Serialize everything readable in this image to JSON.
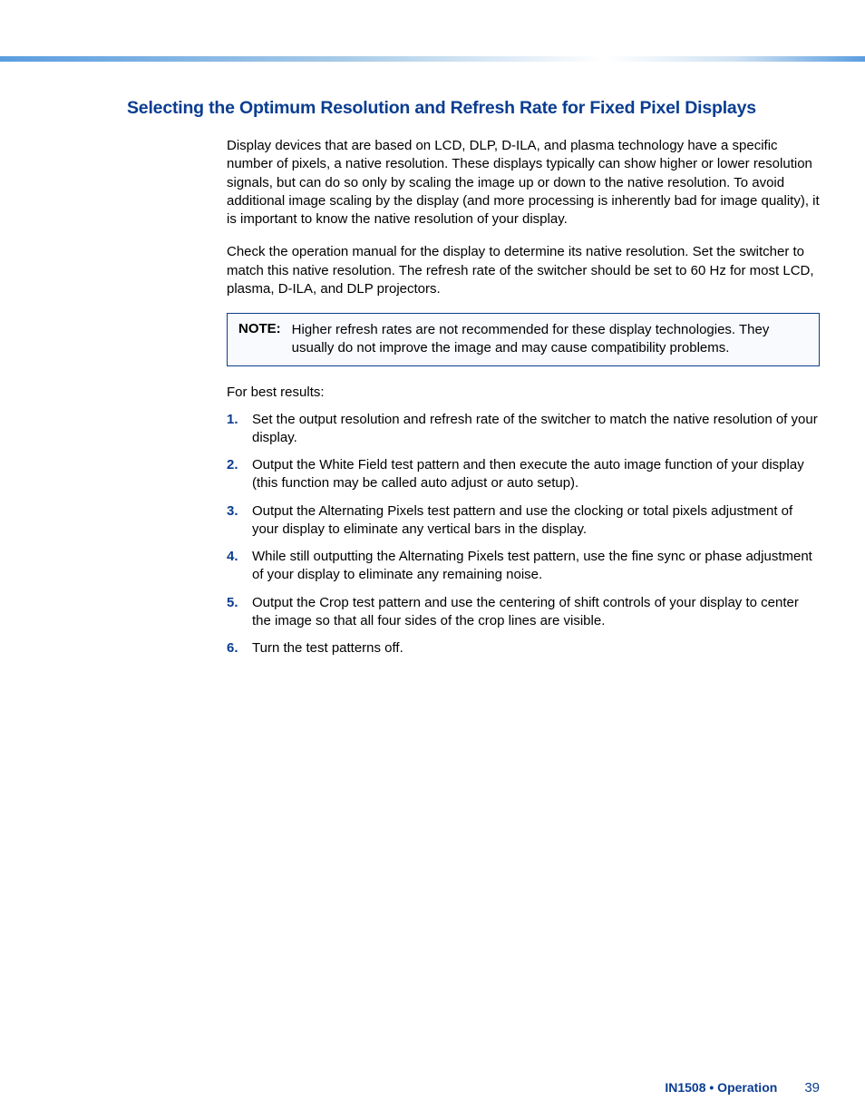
{
  "heading": "Selecting the Optimum Resolution and Refresh Rate for Fixed Pixel Displays",
  "para1": "Display devices that are based on LCD, DLP, D-ILA, and plasma technology have a specific number of pixels, a native resolution. These displays typically can show higher or lower resolution signals, but can do so only by scaling the image up or down to the native resolution. To avoid additional image scaling by the display (and more processing is inherently bad for image quality), it is important to know the native resolution of your display.",
  "para2": "Check the operation manual for the display to determine its native resolution. Set the switcher to match this native resolution. The refresh rate of the switcher should be set to 60 Hz for most LCD, plasma, D-ILA, and DLP projectors.",
  "note": {
    "label": "NOTE:",
    "text": "Higher refresh rates are not recommended for these display technologies. They usually do not improve the image and may cause compatibility problems."
  },
  "intro": "For best results:",
  "steps": [
    {
      "num": "1.",
      "text": "Set the output resolution and refresh rate of the switcher to match the native resolution of your display."
    },
    {
      "num": "2.",
      "text": "Output the White Field test pattern and then execute the auto image function of your display (this function may be called auto adjust or auto setup)."
    },
    {
      "num": "3.",
      "text": "Output the Alternating Pixels test pattern and use the clocking or total pixels adjustment of your display to eliminate any vertical bars in the display."
    },
    {
      "num": "4.",
      "text": "While still outputting the Alternating Pixels test pattern, use the fine sync or phase adjustment of your display to eliminate any remaining noise."
    },
    {
      "num": "5.",
      "text": "Output the Crop test pattern and use the centering of shift controls of your display to center the image so that all four sides of the crop lines are visible."
    },
    {
      "num": "6.",
      "text": "Turn the test patterns off."
    }
  ],
  "footer": {
    "label": "IN1508 • Operation",
    "page": "39"
  }
}
